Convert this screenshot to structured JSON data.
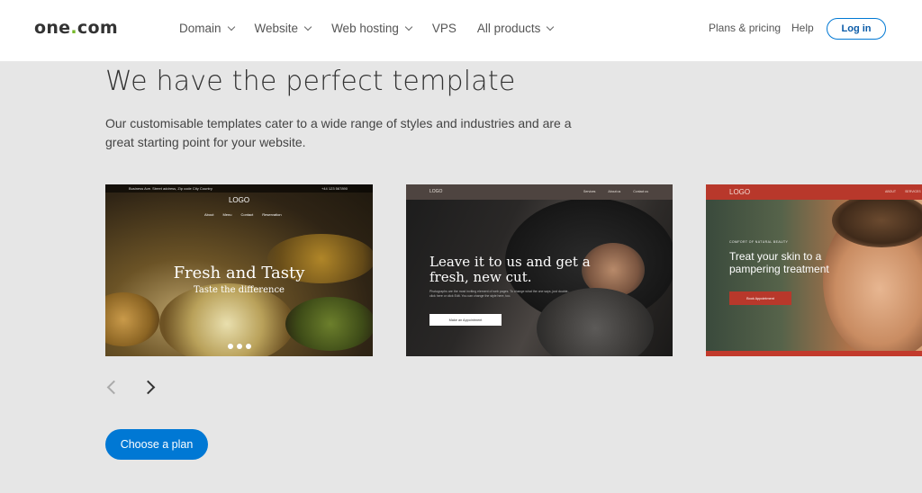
{
  "header": {
    "logo_main": "one",
    "logo_dot": ".",
    "logo_tail": "com",
    "nav": [
      {
        "label": "Domain"
      },
      {
        "label": "Website"
      },
      {
        "label": "Web hosting"
      },
      {
        "label": "VPS"
      },
      {
        "label": "All products"
      }
    ],
    "plans_label": "Plans & pricing",
    "help_label": "Help",
    "login_label": "Log in"
  },
  "main": {
    "heading": "We have the perfect template",
    "subtext": "Our customisable templates cater to a wide range of styles and industries and are a great starting point for your website.",
    "cta_label": "Choose a plan"
  },
  "templates": [
    {
      "topbar_left": "Business Ave. Street address, Zip code City Country",
      "topbar_right": "+44 123 567890",
      "logo": "LOGO",
      "menu": [
        "About",
        "Menu",
        "Contact",
        "Reservation"
      ],
      "title": "Fresh and Tasty",
      "subtitle": "Taste the difference"
    },
    {
      "logo": "LOGO",
      "menu": [
        "Services",
        "About us",
        "Contact us"
      ],
      "title": "Leave it to us and get a fresh, new cut.",
      "body": "Photographs are the most inviting element of web pages. To change what the one says, just double-click here or click Edit. You can change the style here, too.",
      "button": "Make an Appointment"
    },
    {
      "logo": "LOGO",
      "menu": [
        "ABOUT",
        "SERVICES"
      ],
      "kicker": "COMFORT OF NATURAL BEAUTY",
      "title": "Treat your skin to a pampering treatment",
      "button": "Book Appointment"
    }
  ],
  "colors": {
    "accent": "#0078d4",
    "logo_dot": "#76b82a",
    "page_bg": "#e6e6e6",
    "card3_red": "#b8382b"
  },
  "icons": {
    "prev": "chevron-left-icon",
    "next": "chevron-right-icon"
  }
}
